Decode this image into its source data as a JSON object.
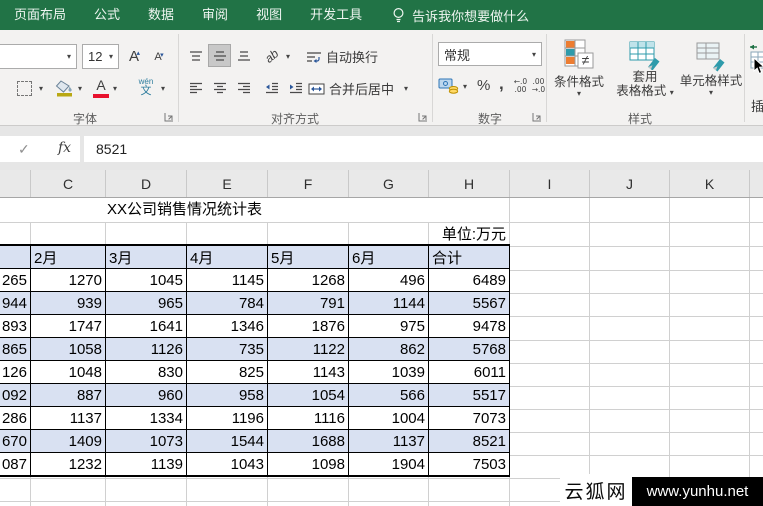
{
  "tabbar": {
    "tabs": [
      "页面布局",
      "公式",
      "数据",
      "审阅",
      "视图",
      "开发工具"
    ],
    "tell_me": "告诉我你想要做什么",
    "accent_green": "#217346"
  },
  "ribbon": {
    "font_group": {
      "label": "字体",
      "font_size_value": "12",
      "pinyin_top": "wén",
      "pinyin_bottom": "文"
    },
    "alignment_group": {
      "label": "对齐方式",
      "orientation_glyph": "ab",
      "wrap_text_label": "自动换行",
      "merge_center_label": "合并后居中"
    },
    "number_group": {
      "label": "数字",
      "format_value": "常规",
      "percent": "%",
      "comma": ",",
      "inc_decimal": "←.0\n.00",
      "dec_decimal": ".00\n→.0"
    },
    "styles_group": {
      "label": "样式",
      "conditional_format_label": "条件格式",
      "format_as_table_line1": "套用",
      "format_as_table_line2": "表格格式",
      "cell_styles_label": "单元格样式"
    },
    "insert_label": "插"
  },
  "formula_bar": {
    "enter_glyph": "✓",
    "fx_label": "fx",
    "value": "8521"
  },
  "sheet": {
    "column_headers": [
      "C",
      "D",
      "E",
      "F",
      "G",
      "H",
      "I",
      "J",
      "K"
    ],
    "title": "XX公司销售情况统计表",
    "unit_label": "单位:万元",
    "month_headers": [
      "2月",
      "3月",
      "4月",
      "5月",
      "6月",
      "合计"
    ],
    "rows": [
      [
        "265",
        1270,
        1045,
        1145,
        1268,
        496,
        6489
      ],
      [
        "944",
        939,
        965,
        784,
        791,
        1144,
        5567
      ],
      [
        "893",
        1747,
        1641,
        1346,
        1876,
        975,
        9478
      ],
      [
        "865",
        1058,
        1126,
        735,
        1122,
        862,
        5768
      ],
      [
        "126",
        1048,
        830,
        825,
        1143,
        1039,
        6011
      ],
      [
        "092",
        887,
        960,
        958,
        1054,
        566,
        5517
      ],
      [
        "286",
        1137,
        1334,
        1196,
        1116,
        1004,
        7073
      ],
      [
        "670",
        1409,
        1073,
        1544,
        1688,
        1137,
        8521
      ],
      [
        "087",
        1232,
        1139,
        1043,
        1098,
        1904,
        7503
      ]
    ],
    "fill_blue": "#d9e1f2"
  },
  "watermark": {
    "site_name": "云狐网",
    "site_url": "www.yunhu.net"
  }
}
